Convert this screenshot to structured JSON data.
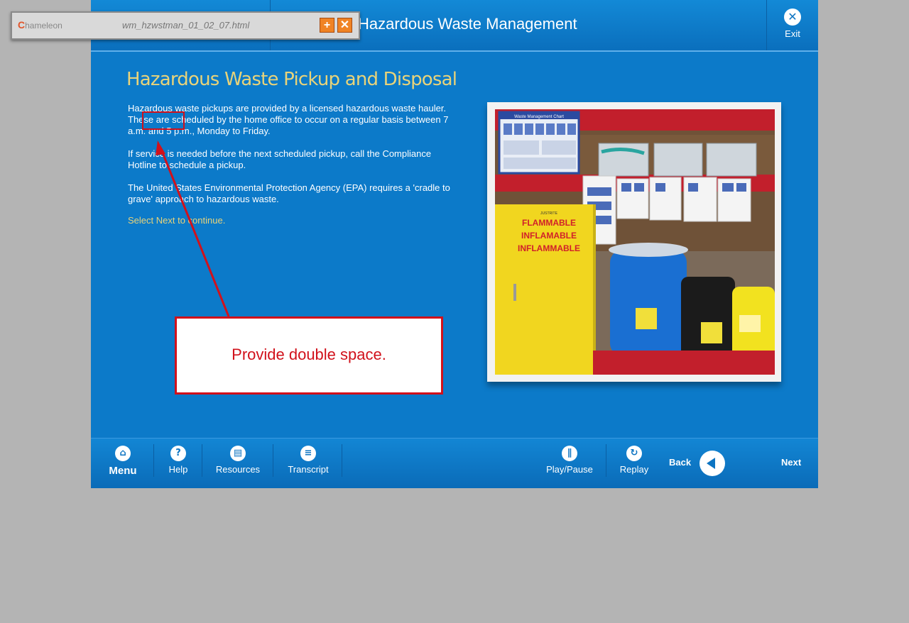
{
  "course": {
    "title": "Hazardous Waste Management",
    "exit_label": "Exit"
  },
  "slide": {
    "title": "Hazardous Waste Pickup and Disposal",
    "paragraphs": [
      "Hazardous waste pickups are provided by a licensed hazardous waste hauler.  These are scheduled by the home office to occur on a regular basis between 7 a.m. and 5 p.m., Monday to Friday.",
      "If service is needed before the next scheduled pickup, call the Compliance Hotline to schedule a pickup.",
      "The United States Environmental Protection Agency (EPA) requires a 'cradle to grave' approach to hazardous waste."
    ],
    "instruction": "Select Next to continue.",
    "photo_labels": {
      "chart_title": "Waste Management Chart",
      "flammable": "FLAMMABLE",
      "inflammable": "INFLAMABLE",
      "inflammable_fr": "INFLAMMABLE",
      "brand": "JUSTRITE"
    }
  },
  "footer": {
    "menu": "Menu",
    "help": "Help",
    "resources": "Resources",
    "transcript": "Transcript",
    "play_pause": "Play/Pause",
    "replay": "Replay",
    "back": "Back",
    "next": "Next"
  },
  "review_tool": {
    "logo": "hameleon",
    "logo_initial": "C",
    "filename": "wm_hzwstman_01_02_07.html",
    "plus": "+",
    "close": "✕"
  },
  "annotation": {
    "comment": "Provide double space."
  },
  "icons": {
    "exit": "close-icon",
    "menu": "home-icon",
    "help": "question-icon",
    "resources": "document-icon",
    "transcript": "list-icon",
    "play_pause": "pause-icon",
    "replay": "replay-icon",
    "back": "back-arrow-icon"
  },
  "colors": {
    "course_blue": "#0c7ac9",
    "title_gold": "#e8d37a",
    "annotation_red": "#d1111b",
    "page_gray": "#b4b4b4"
  }
}
